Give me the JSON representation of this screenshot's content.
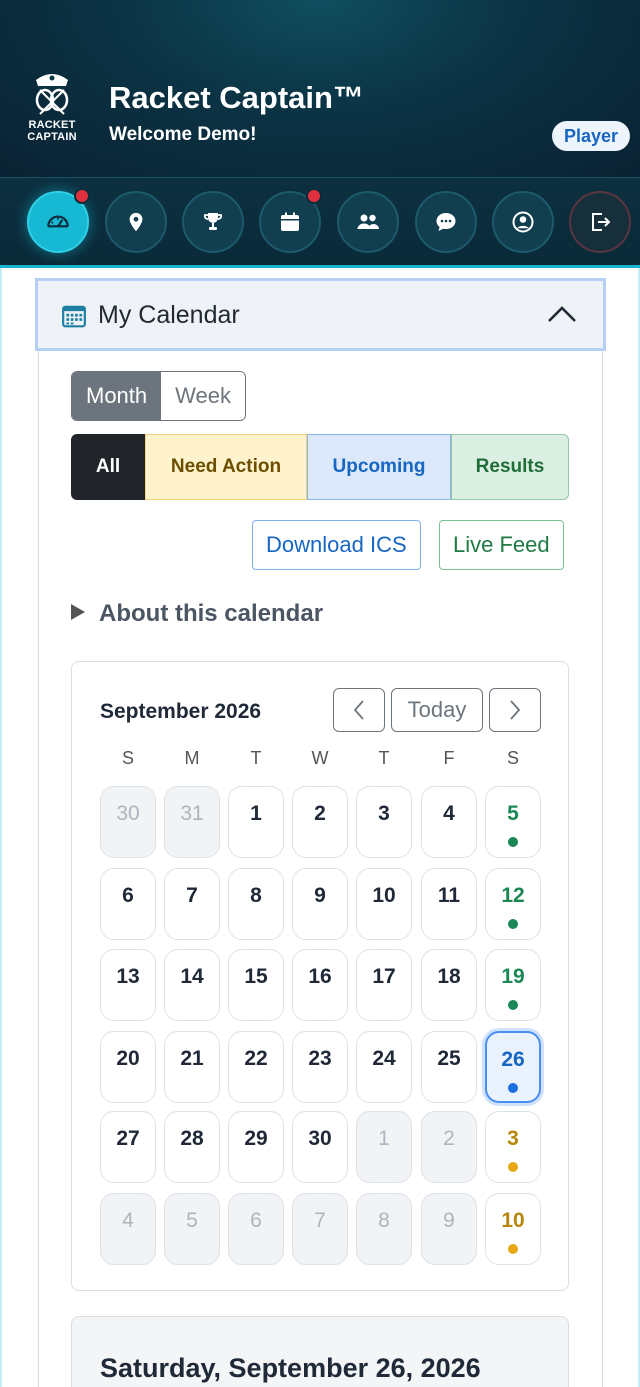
{
  "app": {
    "title": "Racket Captain™",
    "welcome": "Welcome Demo!",
    "role": "Player",
    "logo_line1": "RACKET",
    "logo_line2": "CAPTAIN"
  },
  "nav": [
    {
      "name": "dashboard",
      "icon": "speedometer-icon",
      "active": true,
      "notify": true
    },
    {
      "name": "locations",
      "icon": "map-pin-icon",
      "active": false,
      "notify": false
    },
    {
      "name": "leagues",
      "icon": "trophy-icon",
      "active": false,
      "notify": false
    },
    {
      "name": "calendar",
      "icon": "calendar-icon",
      "active": false,
      "notify": true
    },
    {
      "name": "teams",
      "icon": "people-icon",
      "active": false,
      "notify": false
    },
    {
      "name": "messages",
      "icon": "chat-icon",
      "active": false,
      "notify": false
    },
    {
      "name": "profile",
      "icon": "user-circle-icon",
      "active": false,
      "notify": false
    },
    {
      "name": "logout",
      "icon": "logout-icon",
      "active": false,
      "notify": false
    }
  ],
  "calendar_section": {
    "title": "My Calendar",
    "view_toggle": {
      "month": "Month",
      "week": "Week",
      "selected": "Month"
    },
    "filters": {
      "all": "All",
      "need_action": "Need Action",
      "upcoming": "Upcoming",
      "results": "Results",
      "selected": "All"
    },
    "download_ics": "Download ICS",
    "live_feed": "Live Feed",
    "about": "About this calendar"
  },
  "month_view": {
    "label": "September 2026",
    "today": "Today",
    "weekdays": [
      "S",
      "M",
      "T",
      "W",
      "T",
      "F",
      "S"
    ],
    "weeks": [
      [
        {
          "d": "30",
          "m": true
        },
        {
          "d": "31",
          "m": true
        },
        {
          "d": "1"
        },
        {
          "d": "2"
        },
        {
          "d": "3"
        },
        {
          "d": "4"
        },
        {
          "d": "5",
          "s": "green"
        }
      ],
      [
        {
          "d": "6"
        },
        {
          "d": "7"
        },
        {
          "d": "8"
        },
        {
          "d": "9"
        },
        {
          "d": "10"
        },
        {
          "d": "11"
        },
        {
          "d": "12",
          "s": "green"
        }
      ],
      [
        {
          "d": "13"
        },
        {
          "d": "14"
        },
        {
          "d": "15"
        },
        {
          "d": "16"
        },
        {
          "d": "17"
        },
        {
          "d": "18"
        },
        {
          "d": "19",
          "s": "green"
        }
      ],
      [
        {
          "d": "20"
        },
        {
          "d": "21"
        },
        {
          "d": "22"
        },
        {
          "d": "23"
        },
        {
          "d": "24"
        },
        {
          "d": "25"
        },
        {
          "d": "26",
          "s": "blue",
          "sel": true
        }
      ],
      [
        {
          "d": "27"
        },
        {
          "d": "28"
        },
        {
          "d": "29"
        },
        {
          "d": "30"
        },
        {
          "d": "1",
          "m": true
        },
        {
          "d": "2",
          "m": true
        },
        {
          "d": "3",
          "s": "amber"
        }
      ],
      [
        {
          "d": "4",
          "m": true
        },
        {
          "d": "5",
          "m": true
        },
        {
          "d": "6",
          "m": true
        },
        {
          "d": "7",
          "m": true
        },
        {
          "d": "8",
          "m": true
        },
        {
          "d": "9",
          "m": true
        },
        {
          "d": "10",
          "s": "amber"
        }
      ]
    ]
  },
  "selected_day": {
    "title": "Saturday, September 26, 2026"
  },
  "colors": {
    "accent": "#16b8d4",
    "header_bg": "#0b3344",
    "status_green": "#1a8754",
    "status_blue": "#1c6fe0",
    "status_amber": "#e6a817"
  }
}
